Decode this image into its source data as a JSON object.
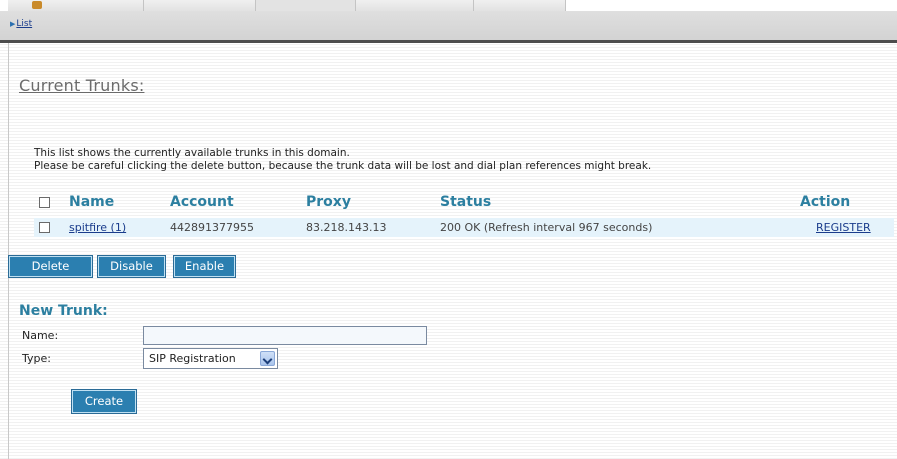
{
  "breadcrumb": {
    "list_label": "List"
  },
  "section_title": "Current Trunks:",
  "info_lines": [
    "This list shows the currently available trunks in this domain.",
    "Please be careful clicking the delete button, because the trunk data will be lost and dial plan references might break."
  ],
  "table": {
    "columns": [
      "Name",
      "Account",
      "Proxy",
      "Status",
      "Action"
    ],
    "rows": [
      {
        "name": "spitfire (1)",
        "account": "442891377955",
        "proxy": "83.218.143.13",
        "status": "200 OK (Refresh interval 967 seconds)",
        "action": "REGISTER"
      }
    ]
  },
  "buttons": {
    "delete": "Delete",
    "disable": "Disable",
    "enable": "Enable",
    "create": "Create"
  },
  "new_trunk": {
    "title": "New Trunk:",
    "name_label": "Name:",
    "name_value": "",
    "type_label": "Type:",
    "type_value": "SIP Registration"
  },
  "colors": {
    "accent": "#2c7fa0",
    "button": "#2b7fb0",
    "link": "#1a3c8c",
    "row_highlight": "#e5f3fb"
  }
}
